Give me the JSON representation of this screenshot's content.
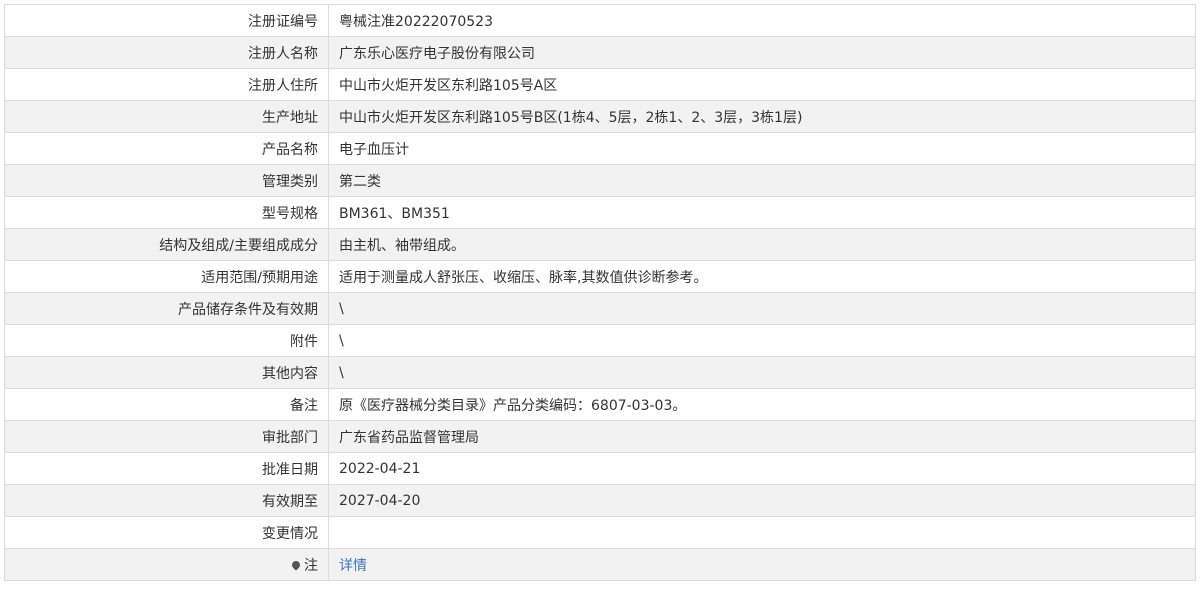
{
  "rows": [
    {
      "label": "注册证编号",
      "value": "粤械注准20222070523"
    },
    {
      "label": "注册人名称",
      "value": "广东乐心医疗电子股份有限公司"
    },
    {
      "label": "注册人住所",
      "value": "中山市火炬开发区东利路105号A区"
    },
    {
      "label": "生产地址",
      "value": "中山市火炬开发区东利路105号B区(1栋4、5层，2栋1、2、3层，3栋1层)"
    },
    {
      "label": "产品名称",
      "value": "电子血压计"
    },
    {
      "label": "管理类别",
      "value": "第二类"
    },
    {
      "label": "型号规格",
      "value": "BM361、BM351"
    },
    {
      "label": "结构及组成/主要组成成分",
      "value": "由主机、袖带组成。"
    },
    {
      "label": "适用范围/预期用途",
      "value": "适用于测量成人舒张压、收缩压、脉率,其数值供诊断参考。"
    },
    {
      "label": "产品储存条件及有效期",
      "value": "\\"
    },
    {
      "label": "附件",
      "value": "\\"
    },
    {
      "label": "其他内容",
      "value": "\\"
    },
    {
      "label": "备注",
      "value": "原《医疗器械分类目录》产品分类编码：6807-03-03。"
    },
    {
      "label": "审批部门",
      "value": "广东省药品监督管理局"
    },
    {
      "label": "批准日期",
      "value": "2022-04-21"
    },
    {
      "label": "有效期至",
      "value": "2027-04-20"
    },
    {
      "label": "变更情况",
      "value": ""
    }
  ],
  "note_row": {
    "label": "注",
    "icon": "pin-icon",
    "link_text": "详情"
  },
  "colors": {
    "link": "#3a74c4",
    "row_alt": "#f2f2f2",
    "border": "#dcdcdc"
  }
}
